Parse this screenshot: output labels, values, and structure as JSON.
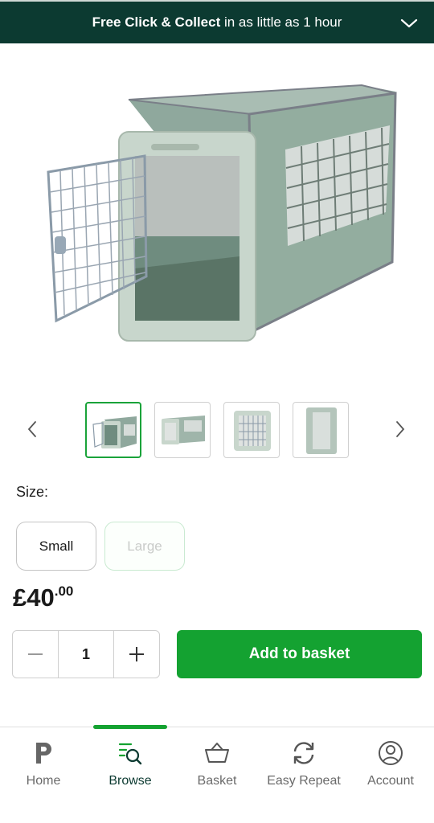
{
  "banner": {
    "bold_text": "Free Click & Collect",
    "rest_text": " in as little as 1 hour",
    "chevron_icon": "chevron-down-icon"
  },
  "product": {
    "image_icon": "pet-crate-image",
    "gallery": {
      "prev_icon": "chevron-left-icon",
      "next_icon": "chevron-right-icon",
      "thumbnails": [
        "crate-side-view",
        "crate-front-angle",
        "crate-door-front",
        "crate-end-view"
      ]
    },
    "size_label": "Size:",
    "sizes": [
      "Small",
      "Large"
    ],
    "price_main": "£40",
    "price_pence": ".00",
    "quantity": "1",
    "add_to_basket": "Add to basket"
  },
  "nav": {
    "items": [
      {
        "label": "Home",
        "icon": "home-p-icon"
      },
      {
        "label": "Browse",
        "icon": "browse-search-icon"
      },
      {
        "label": "Basket",
        "icon": "basket-icon"
      },
      {
        "label": "Easy Repeat",
        "icon": "repeat-icon"
      },
      {
        "label": "Account",
        "icon": "account-icon"
      }
    ],
    "active": "Browse"
  },
  "colors": {
    "banner_bg": "#0c3a31",
    "accent_green": "#14a231",
    "text": "#1a1a1a"
  }
}
